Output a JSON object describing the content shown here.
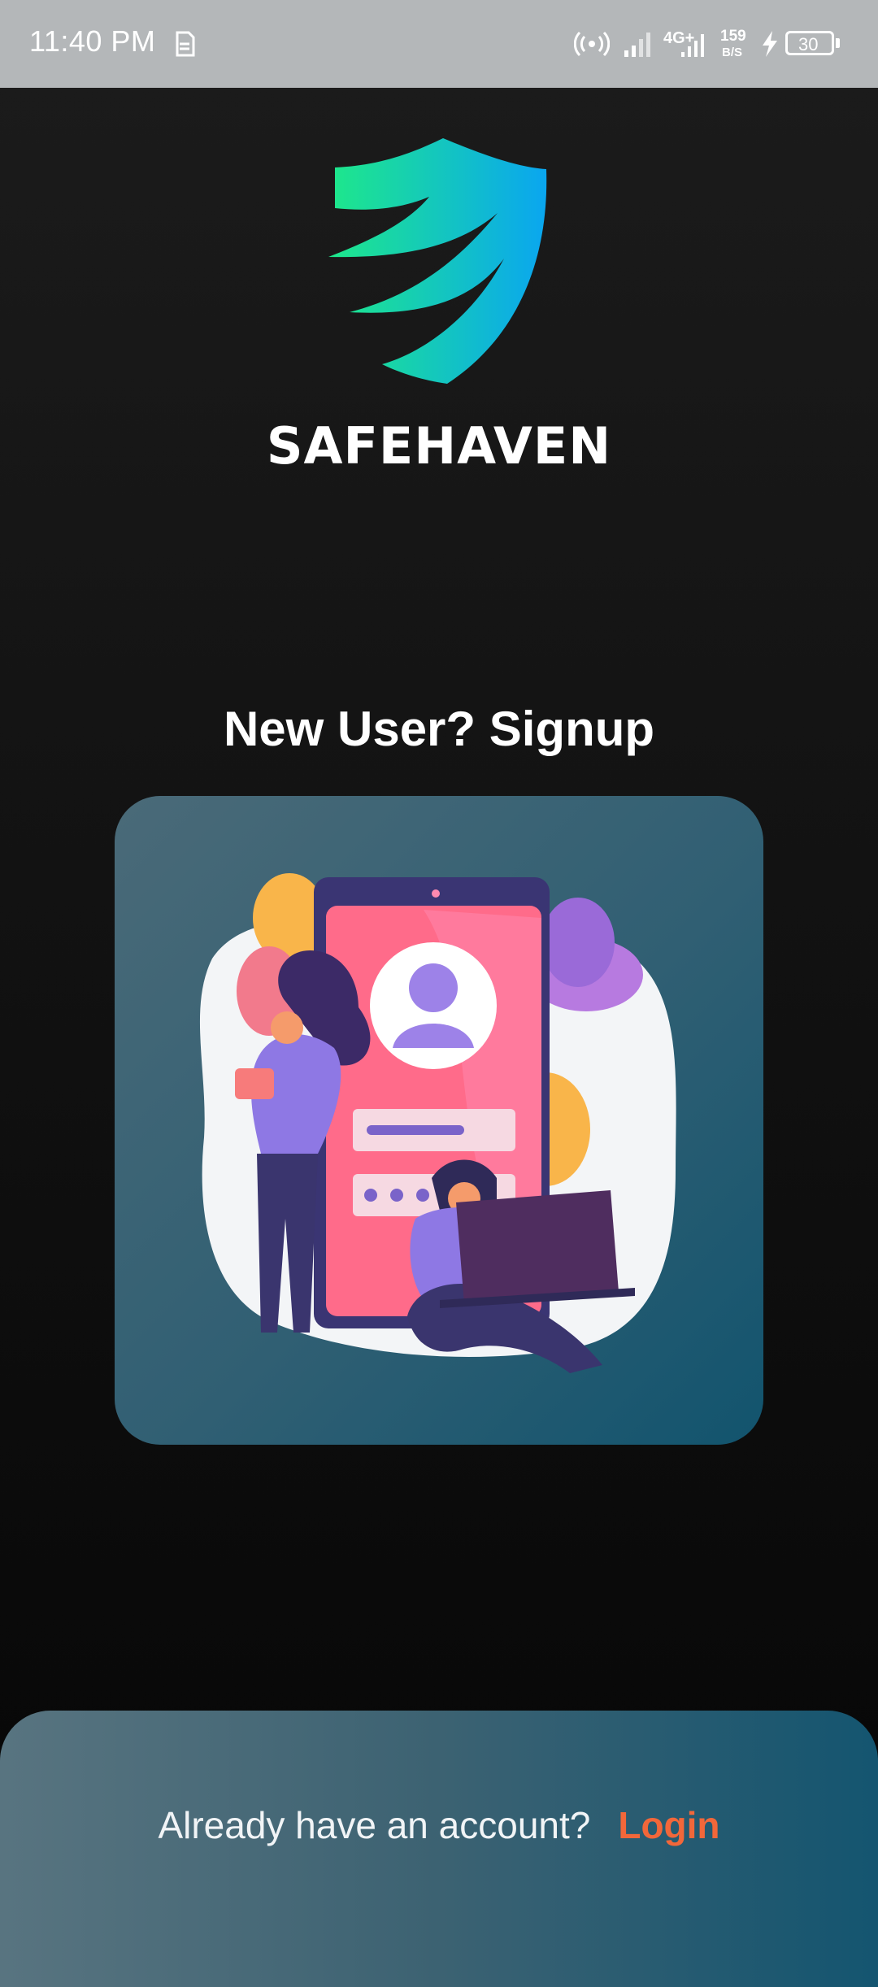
{
  "status_bar": {
    "time": "11:40 PM",
    "network": "4G+",
    "speed_value": "159",
    "speed_unit": "B/S",
    "battery": "30",
    "icons": [
      "sim-icon",
      "hotspot-icon",
      "signal-icon",
      "signal-4g-icon",
      "charging-icon",
      "battery-icon"
    ]
  },
  "brand": {
    "name": "SAFEHAVEN",
    "logo_icon": "shield-logo",
    "logo_colors": [
      "#1ee88a",
      "#0aa6f0"
    ]
  },
  "headline": "New User? Signup",
  "illustration": {
    "icon": "signup-illustration"
  },
  "footer": {
    "question": "Already have an account?",
    "login_label": "Login",
    "login_color": "#f2673a"
  }
}
